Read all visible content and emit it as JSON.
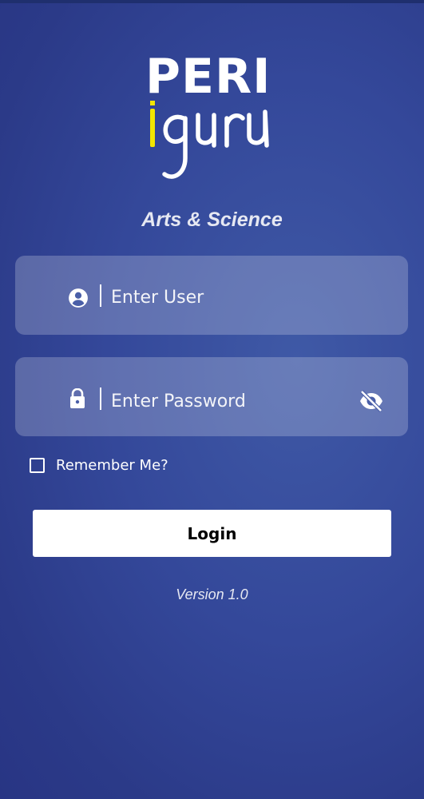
{
  "brand": {
    "logo_top": "PERI",
    "logo_bottom": "iguru",
    "tagline": "Arts & Science"
  },
  "form": {
    "user": {
      "placeholder": "Enter User",
      "icon": "account-circle-icon"
    },
    "password": {
      "placeholder": "Enter Password",
      "icon": "lock-icon",
      "toggle_icon": "eye-off-icon"
    },
    "remember_label": "Remember Me?",
    "remember_checked": false,
    "login_label": "Login"
  },
  "footer": {
    "version": "Version 1.0"
  },
  "colors": {
    "background": "#34489a",
    "accent_yellow": "#f2e600",
    "field_fill": "rgba(255,255,255,0.22)",
    "button_fill": "#ffffff"
  }
}
